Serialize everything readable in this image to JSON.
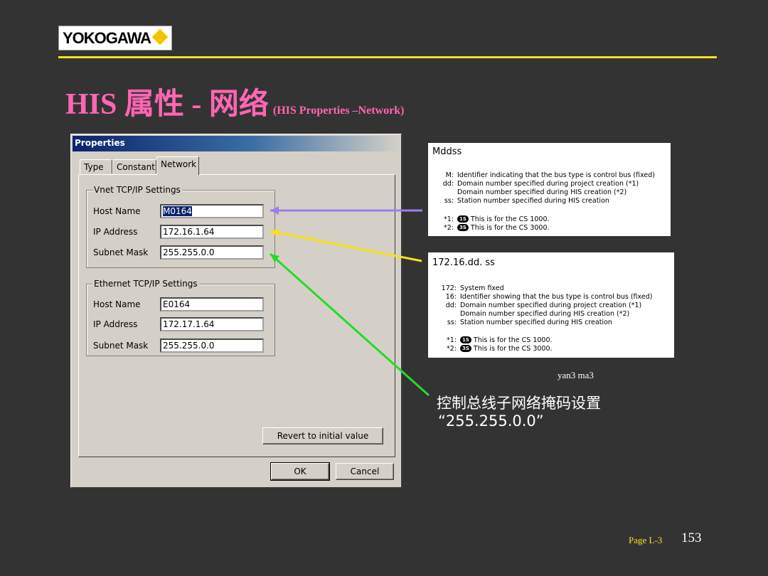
{
  "logo": {
    "text": "YOKOGAWA",
    "accent": "#f5c400"
  },
  "title": {
    "main": "HIS 属性  - 网络",
    "sub": "(HIS Properties –Network)",
    "color": "#ff66b3"
  },
  "dialog": {
    "title": "Properties",
    "tabs": [
      {
        "label": "Type"
      },
      {
        "label": "Constant"
      },
      {
        "label": "Network",
        "active": true
      }
    ],
    "vnet": {
      "label": "Vnet TCP/IP Settings",
      "host_label": "Host Name",
      "host_value": "M0164",
      "ip_label": "IP Address",
      "ip_value": "172.16.1.64",
      "mask_label": "Subnet Mask",
      "mask_value": "255.255.0.0"
    },
    "ethernet": {
      "label": "Ethernet TCP/IP Settings",
      "host_label": "Host Name",
      "host_value": "E0164",
      "ip_label": "IP Address",
      "ip_value": "172.17.1.64",
      "mask_label": "Subnet Mask",
      "mask_value": "255.255.0.0"
    },
    "revert_label": "Revert to initial value",
    "ok_label": "OK",
    "cancel_label": "Cancel"
  },
  "note1": {
    "heading": "Mddss",
    "rows": [
      {
        "k": "M:",
        "v": "Identifier indicating that the bus type is control bus (fixed)"
      },
      {
        "k": "dd:",
        "v": "Domain number specified during project creation (*1)"
      },
      {
        "k": "",
        "v": "Domain number specified during HIS creation (*2)"
      },
      {
        "k": "ss:",
        "v": "Station number specified during HIS creation"
      }
    ],
    "foot1_k": "*1:",
    "foot1_badge": "1S",
    "foot1_v": "This is for the CS 1000.",
    "foot2_k": "*2:",
    "foot2_badge": "3S",
    "foot2_v": "This is for the CS 3000."
  },
  "note2": {
    "heading": "172.16.dd. ss",
    "rows": [
      {
        "k": "172:",
        "v": "System fixed"
      },
      {
        "k": "16:",
        "v": "Identifier showing that the bus type is control bus (fixed)"
      },
      {
        "k": "dd:",
        "v": "Domain number specified during project creation (*1)"
      },
      {
        "k": "",
        "v": "Domain number specified during HIS creation (*2)"
      },
      {
        "k": "ss:",
        "v": "Station number specified during HIS creation"
      }
    ],
    "foot1_k": "*1:",
    "foot1_badge": "1S",
    "foot1_v": "This is for the CS 1000.",
    "foot2_k": "*2:",
    "foot2_badge": "3S",
    "foot2_v": "This is for the CS 3000."
  },
  "annotation": {
    "yan": "yan3 ma3",
    "line1": "控制总线子网络掩码设置",
    "line2": "“255.255.0.0”"
  },
  "footer": {
    "page_label": "Page L-3",
    "page_number": "153"
  },
  "colors": {
    "arrow_host": "#9b7df0",
    "arrow_ip": "#f5e21a",
    "arrow_mask": "#22dd22"
  }
}
